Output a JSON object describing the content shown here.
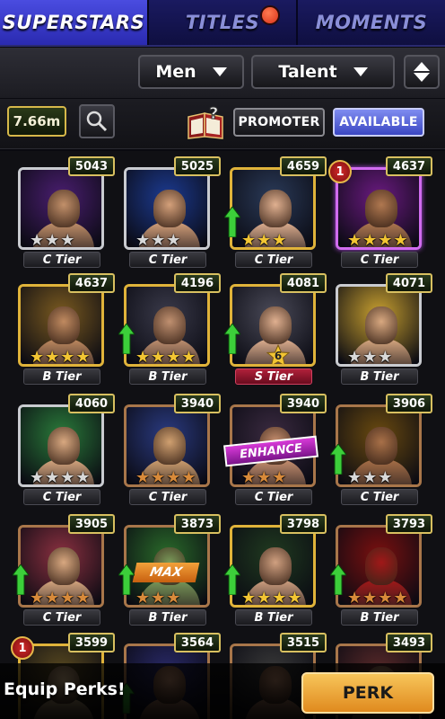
{
  "tabs": [
    {
      "label": "SUPERSTARS",
      "active": true
    },
    {
      "label": "TITLES",
      "active": false
    },
    {
      "label": "MOMENTS",
      "active": false
    }
  ],
  "filters": {
    "gender": "Men",
    "sort": "Talent"
  },
  "currency": {
    "value": "7.66m"
  },
  "toggles": {
    "promoter": "PROMOTER",
    "available": "AVAILABLE"
  },
  "cards": [
    {
      "power": "5043",
      "tier": "C Tier",
      "stars": 3,
      "star_color": "silver",
      "frame": "silver",
      "portrait": "#4a1e70",
      "skin": "#c2906a"
    },
    {
      "power": "5025",
      "tier": "C Tier",
      "stars": 3,
      "star_color": "silver",
      "frame": "silver",
      "portrait": "#1c3a90",
      "skin": "#d4a07a"
    },
    {
      "power": "4659",
      "tier": "C Tier",
      "stars": 3,
      "star_color": "gold",
      "frame": "gold",
      "portrait": "#2a3a58",
      "skin": "#e0b090",
      "upgrade": true
    },
    {
      "power": "4637",
      "tier": "C Tier",
      "stars": 4,
      "star_color": "gold",
      "frame": "purple",
      "portrait": "#6a1a80",
      "skin": "#b07850",
      "badge": "1"
    },
    {
      "power": "4637",
      "tier": "B Tier",
      "stars": 4,
      "star_color": "gold",
      "frame": "gold",
      "portrait": "#7a5a20",
      "skin": "#c08a60"
    },
    {
      "power": "4196",
      "tier": "B Tier",
      "stars": 4,
      "star_color": "gold",
      "frame": "gold",
      "portrait": "#3a3a4a",
      "skin": "#c09070",
      "upgrade": true
    },
    {
      "power": "4081",
      "tier": "S Tier",
      "stars": 0,
      "star_color": "gold",
      "frame": "gold",
      "portrait": "#4a4a58",
      "skin": "#e0b090",
      "upgrade": true,
      "star_badge": "6"
    },
    {
      "power": "4071",
      "tier": "B Tier",
      "stars": 3,
      "star_color": "silver",
      "frame": "silver",
      "portrait": "#c8a030",
      "skin": "#d8a880"
    },
    {
      "power": "4060",
      "tier": "C Tier",
      "stars": 4,
      "star_color": "silver",
      "frame": "silver",
      "portrait": "#2a7a3a",
      "skin": "#d8a880"
    },
    {
      "power": "3940",
      "tier": "C Tier",
      "stars": 4,
      "star_color": "bronze",
      "frame": "bronze",
      "portrait": "#2a3a80",
      "skin": "#d0a070"
    },
    {
      "power": "3940",
      "tier": "C Tier",
      "stars": 3,
      "star_color": "bronze",
      "frame": "bronze",
      "portrait": "#3a2a40",
      "skin": "#c89070",
      "enhance": "ENHANCE"
    },
    {
      "power": "3906",
      "tier": "C Tier",
      "stars": 3,
      "star_color": "silver",
      "frame": "bronze",
      "portrait": "#6a4a10",
      "skin": "#a87048",
      "upgrade": true
    },
    {
      "power": "3905",
      "tier": "C Tier",
      "stars": 4,
      "star_color": "bronze",
      "frame": "bronze",
      "portrait": "#8a3040",
      "skin": "#d8a880",
      "upgrade": true
    },
    {
      "power": "3873",
      "tier": "B Tier",
      "stars": 3,
      "star_color": "bronze",
      "frame": "bronze",
      "portrait": "#2a6a2a",
      "skin": "#7a9a5a",
      "upgrade": true,
      "max": "MAX"
    },
    {
      "power": "3798",
      "tier": "B Tier",
      "stars": 4,
      "star_color": "gold",
      "frame": "gold",
      "portrait": "#203a20",
      "skin": "#d0a080",
      "upgrade": true
    },
    {
      "power": "3793",
      "tier": "B Tier",
      "stars": 4,
      "star_color": "bronze",
      "frame": "bronze",
      "portrait": "#7a1010",
      "skin": "#a01818",
      "upgrade": true
    },
    {
      "power": "3599",
      "tier": "",
      "stars": 0,
      "star_color": "gold",
      "frame": "gold",
      "portrait": "#5a4a20",
      "skin": "#e0c090",
      "badge": "1"
    },
    {
      "power": "3564",
      "tier": "",
      "stars": 0,
      "star_color": "bronze",
      "frame": "bronze",
      "portrait": "#2a2a6a",
      "skin": "#c89070",
      "upgrade": true
    },
    {
      "power": "3515",
      "tier": "",
      "stars": 0,
      "star_color": "bronze",
      "frame": "bronze",
      "portrait": "#3a3a3a",
      "skin": "#c89070"
    },
    {
      "power": "3493",
      "tier": "",
      "stars": 0,
      "star_color": "bronze",
      "frame": "bronze",
      "portrait": "#5a2a2a",
      "skin": "#d0a080",
      "upgrade": true
    }
  ],
  "banner": {
    "text": "Equip Perks!",
    "button": "PERK"
  }
}
